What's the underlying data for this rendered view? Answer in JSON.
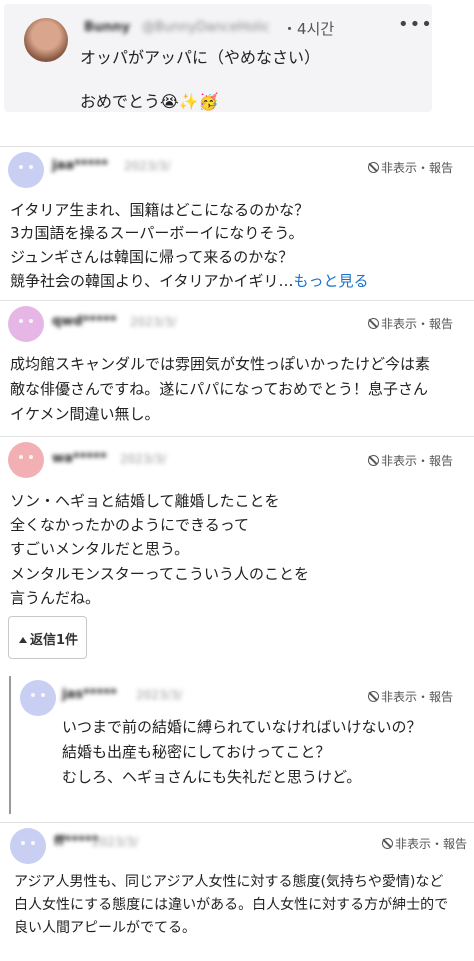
{
  "post": {
    "user_name": "Bunny",
    "user_handle": "@BunnyDanceHolic",
    "time": "・4시간",
    "more_label": "•••",
    "line1": "オッパがアッパに（やめなさい）",
    "line2": "おめでとう😭✨🥳"
  },
  "actions": {
    "hide_report": "非表示・報告"
  },
  "comments": [
    {
      "user": "jaa*****",
      "meta": "2023/3/",
      "lines": [
        "イタリア生まれ、国籍はどこになるのかな？",
        "3カ国語を操るスーパーボーイになりそう。",
        "ジュンギさんは韓国に帰って来るのかな？",
        "競争社会の韓国より、イタリアかイギリ…"
      ],
      "more": "もっと見る"
    },
    {
      "user": "qwd*****",
      "meta": "2023/3/",
      "lines": [
        "成均館スキャンダルでは雰囲気が女性っぽいかったけど今は素",
        "敵な俳優さんですね。遂にパパになっておめでとう！息子さん",
        "イケメン間違い無し。"
      ]
    },
    {
      "user": "wa*****",
      "meta": "2023/3/",
      "lines": [
        "ソン・ヘギョと結婚して離婚したことを",
        "全くなかったかのようにできるって",
        "すごいメンタルだと思う。",
        "メンタルモンスターってこういう人のことを",
        "言うんだね。"
      ],
      "reply_button": "返信1件"
    },
    {
      "user": "jas*****",
      "meta": "2023/3/",
      "lines": [
        "いつまで前の結婚に縛られていなければいけないの？",
        "結婚も出産も秘密にしておけってこと？",
        "むしろ、ヘギョさんにも失礼だと思うけど。"
      ]
    },
    {
      "user": "ff*****",
      "meta": "2023/3/",
      "lines": [
        "アジア人男性も、同じアジア人女性に対する態度(気持ちや愛情)など",
        "白人女性にする態度には違いがある。白人女性に対する方が紳士的で",
        "良い人間アピールがでてる。"
      ]
    }
  ]
}
